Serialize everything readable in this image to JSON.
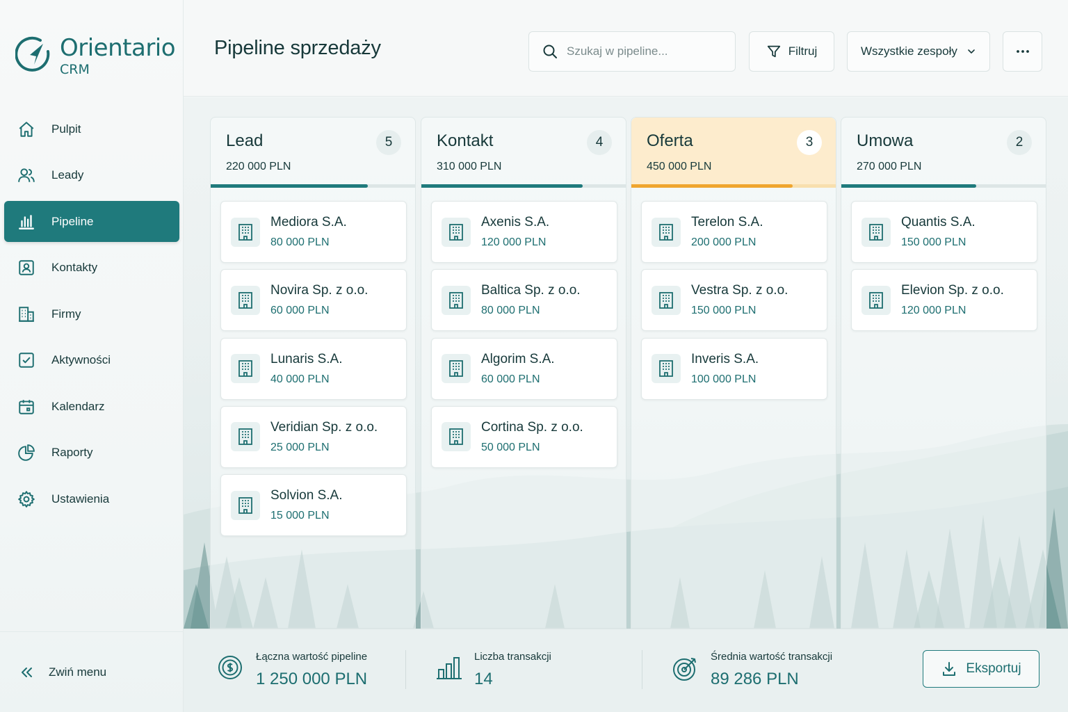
{
  "app": {
    "name": "Orientario",
    "subtitle": "CRM"
  },
  "sidebar": {
    "items": [
      {
        "label": "Pulpit",
        "icon": "home-icon"
      },
      {
        "label": "Leady",
        "icon": "users-icon"
      },
      {
        "label": "Pipeline",
        "icon": "bar-chart-icon",
        "active": true
      },
      {
        "label": "Kontakty",
        "icon": "contact-card-icon"
      },
      {
        "label": "Firmy",
        "icon": "building-icon"
      },
      {
        "label": "Aktywności",
        "icon": "check-square-icon"
      },
      {
        "label": "Kalendarz",
        "icon": "calendar-icon"
      },
      {
        "label": "Raporty",
        "icon": "pie-chart-icon"
      },
      {
        "label": "Ustawienia",
        "icon": "gear-icon"
      }
    ],
    "collapse_label": "Zwiń menu"
  },
  "header": {
    "title": "Pipeline sprzedaży",
    "search_placeholder": "Szukaj w pipeline...",
    "filter_label": "Filtruj",
    "teams_label": "Wszystkie zespoły"
  },
  "columns": [
    {
      "title": "Lead",
      "count": "5",
      "total": "220 000 PLN",
      "progress": 0.77,
      "cards": [
        {
          "name": "Mediora S.A.",
          "value": "80 000 PLN"
        },
        {
          "name": "Novira Sp. z o.o.",
          "value": "60 000 PLN"
        },
        {
          "name": "Lunaris S.A.",
          "value": "40 000 PLN"
        },
        {
          "name": "Veridian Sp. z o.o.",
          "value": "25 000 PLN"
        },
        {
          "name": "Solvion S.A.",
          "value": "15 000 PLN"
        }
      ]
    },
    {
      "title": "Kontakt",
      "count": "4",
      "total": "310 000 PLN",
      "progress": 0.79,
      "cards": [
        {
          "name": "Axenis S.A.",
          "value": "120 000 PLN"
        },
        {
          "name": "Baltica Sp. z o.o.",
          "value": "80 000 PLN"
        },
        {
          "name": "Algorim S.A.",
          "value": "60 000 PLN"
        },
        {
          "name": "Cortina Sp. z o.o.",
          "value": "50 000 PLN"
        }
      ]
    },
    {
      "title": "Oferta",
      "count": "3",
      "total": "450 000 PLN",
      "progress": 0.79,
      "highlight": true,
      "cards": [
        {
          "name": "Terelon S.A.",
          "value": "200 000 PLN"
        },
        {
          "name": "Vestra Sp. z o.o.",
          "value": "150 000 PLN"
        },
        {
          "name": "Inveris S.A.",
          "value": "100 000 PLN"
        }
      ]
    },
    {
      "title": "Umowa",
      "count": "2",
      "total": "270 000 PLN",
      "progress": 0.66,
      "cards": [
        {
          "name": "Quantis S.A.",
          "value": "150 000 PLN"
        },
        {
          "name": "Elevion Sp. z o.o.",
          "value": "120 000 PLN"
        }
      ]
    }
  ],
  "footer": {
    "total_label": "Łączna wartość pipeline",
    "total_value": "1 250 000 PLN",
    "count_label": "Liczba transakcji",
    "count_value": "14",
    "avg_label": "Średnia wartość transakcji",
    "avg_value": "89 286 PLN",
    "export_label": "Eksportuj"
  },
  "colors": {
    "accent": "#1f7a7c",
    "highlight": "#efa52e",
    "highlight_bg": "#fdeccd"
  }
}
